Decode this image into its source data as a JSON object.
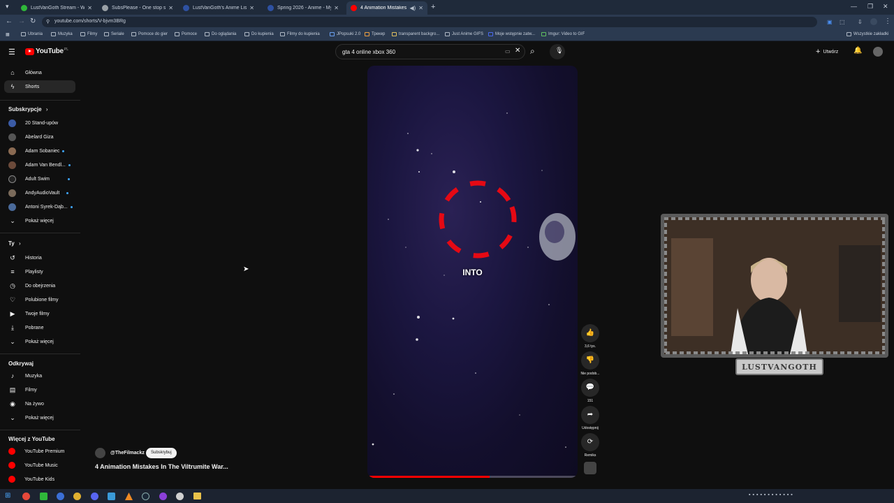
{
  "browser": {
    "tabs": [
      {
        "title": "LustVanGoth Stream - Watch L",
        "color": "#2fb83a"
      },
      {
        "title": "SubsPlease - One stop shop fo",
        "color": "#9aa0a6"
      },
      {
        "title": "LustVanGoth's Anime List - My",
        "color": "#2e51a2"
      },
      {
        "title": "Spring 2026 - Anime - MyAnim",
        "color": "#2e51a2"
      },
      {
        "title": "4 Animation Mistakes In Th",
        "color": "#ff0000"
      }
    ],
    "url": "youtube.com/shorts/V-bjvm3BRg",
    "bookmarks": [
      "Ubrania",
      "Muzyka",
      "Filmy",
      "Seriale",
      "Pomoce do gier",
      "Pomoce",
      "Do oglądania",
      "Do kupienia",
      "Filmy do kupienia",
      "JPopsuki 2.0",
      "Трекер",
      "transparent backgro...",
      "Just Anime GIFS",
      "Moje wstępnie zatw...",
      "Imgur: Video to GIF"
    ],
    "all_bookmarks": "Wszystkie zakładki"
  },
  "header": {
    "logo_text": "YouTube",
    "country_code": "PL",
    "search_value": "gta 4 online xbox 360",
    "create_label": "Utwórz"
  },
  "sidebar": {
    "top": [
      {
        "label": "Główna",
        "icon": "home-icon"
      },
      {
        "label": "Shorts",
        "icon": "shorts-icon"
      }
    ],
    "subscriptions_heading": "Subskrypcje",
    "subscriptions": [
      {
        "label": "20 Stand-upów",
        "color": "#3b5ba5",
        "new": false
      },
      {
        "label": "Abelard Giza",
        "color": "#555555",
        "new": false
      },
      {
        "label": "Adam Sobaniec",
        "color": "#8a6a52",
        "new": true
      },
      {
        "label": "Adam Van Bendl...",
        "color": "#6b4a3a",
        "new": true
      },
      {
        "label": "Adult Swim",
        "color": "#222222",
        "new": true
      },
      {
        "label": "AndyAudioVault",
        "color": "#7a6a5a",
        "new": true
      },
      {
        "label": "Antoni Syrek-Dąb...",
        "color": "#4a6a9a",
        "new": true
      }
    ],
    "show_more": "Pokaż więcej",
    "you_heading": "Ty",
    "you": [
      {
        "label": "Historia",
        "icon": "history-icon"
      },
      {
        "label": "Playlisty",
        "icon": "playlist-icon"
      },
      {
        "label": "Do obejrzenia",
        "icon": "watch-later-icon"
      },
      {
        "label": "Polubione filmy",
        "icon": "like-icon"
      },
      {
        "label": "Twoje filmy",
        "icon": "your-videos-icon"
      },
      {
        "label": "Pobrane",
        "icon": "download-icon"
      }
    ],
    "explore_heading": "Odkrywaj",
    "explore": [
      {
        "label": "Muzyka",
        "icon": "music-icon"
      },
      {
        "label": "Filmy",
        "icon": "movies-icon"
      },
      {
        "label": "Na żywo",
        "icon": "live-icon"
      }
    ],
    "more_heading": "Więcej z YouTube",
    "more": [
      "YouTube Premium",
      "YouTube Music",
      "YouTube Kids"
    ]
  },
  "short": {
    "caption": "INTO",
    "channel": "@TheFilmackz",
    "subscribe_label": "Subskrybuj",
    "title": "4 Animation Mistakes In The Viltrumite War...",
    "progress": 0.58,
    "actions": [
      {
        "label": "3,6 tys.",
        "icon": "thumbs-up-icon",
        "glyph": "👍"
      },
      {
        "label": "Nie podob...",
        "icon": "thumbs-down-icon",
        "glyph": "👎"
      },
      {
        "label": "151",
        "icon": "comment-icon",
        "glyph": "💬"
      },
      {
        "label": "Udostępnij",
        "icon": "share-icon",
        "glyph": "➦"
      },
      {
        "label": "Remiks",
        "icon": "remix-icon",
        "glyph": "⟳"
      }
    ]
  },
  "webcam": {
    "nameplate": "LUSTVANGOTH"
  }
}
